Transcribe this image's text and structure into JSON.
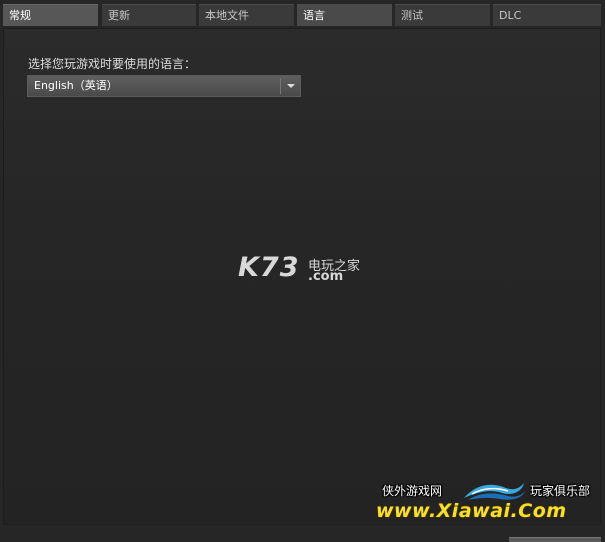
{
  "tabs": [
    {
      "label": "常规",
      "state": "active"
    },
    {
      "label": "更新",
      "state": "normal"
    },
    {
      "label": "本地文件",
      "state": "normal"
    },
    {
      "label": "语言",
      "state": "current"
    },
    {
      "label": "测试",
      "state": "normal"
    },
    {
      "label": "DLC",
      "state": "normal"
    }
  ],
  "language": {
    "label": "选择您玩游戏时要使用的语言：",
    "selected": "English（英语）"
  },
  "watermarks": {
    "k73": {
      "big": "K73",
      "cn": "电玩之家",
      "com": ".com"
    },
    "xiawai": {
      "left_cn": "侠外游戏网",
      "right_cn": "玩家俱乐部",
      "url": "www.Xiawai.Com"
    }
  },
  "colors": {
    "background": "#262626",
    "tab_active": "#575757",
    "tab_normal": "#3a3a3a",
    "dropdown": "#4f4f4f",
    "watermark_yellow": "#f5e12a"
  }
}
